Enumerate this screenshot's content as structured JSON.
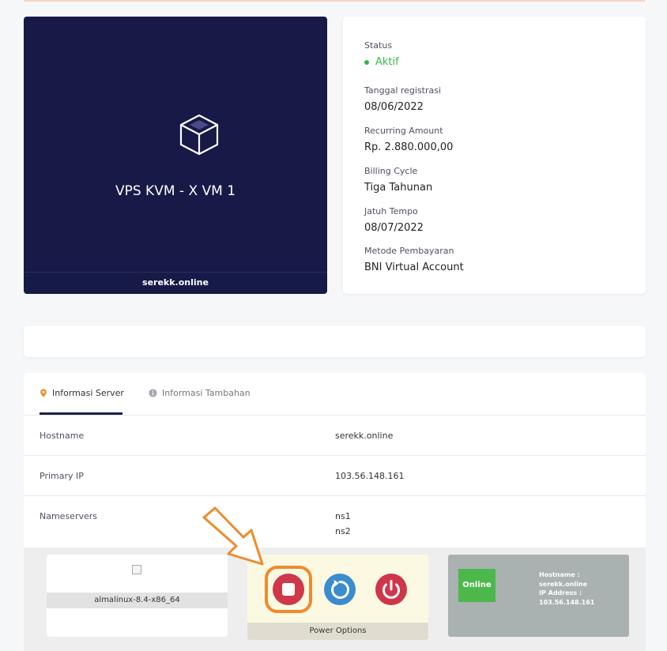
{
  "product": {
    "name": "VPS KVM - X VM 1",
    "domain": "serekk.online",
    "icon": "cube-icon"
  },
  "details": {
    "status_label": "Status",
    "status_value": "Aktif",
    "registration_label": "Tanggal registrasi",
    "registration_value": "08/06/2022",
    "recurring_label": "Recurring Amount",
    "recurring_value": "Rp. 2.880.000,00",
    "billing_label": "Billing Cycle",
    "billing_value": "Tiga Tahunan",
    "due_label": "Jatuh Tempo",
    "due_value": "08/07/2022",
    "payment_label": "Metode Pembayaran",
    "payment_value": "BNI Virtual Account"
  },
  "tabs": [
    {
      "label": "Informasi Server",
      "icon": "location-pin-icon"
    },
    {
      "label": "Informasi Tambahan",
      "icon": "info-icon"
    }
  ],
  "server_info": {
    "hostname_label": "Hostname",
    "hostname_value": "serekk.online",
    "ip_label": "Primary IP",
    "ip_value": "103.56.148.161",
    "ns_label": "Nameservers",
    "ns1": "ns1",
    "ns2": "ns2"
  },
  "os": {
    "label": "almalinux-8.4-x86_64"
  },
  "power": {
    "label": "Power Options"
  },
  "vm_status": {
    "badge": "Online",
    "hostname_label": "Hostname :",
    "hostname_value": "serekk.online",
    "ip_label": "IP Address :",
    "ip_value": "103.56.148.161"
  },
  "colors": {
    "product_bg": "#171a47",
    "status_green": "#39b54a",
    "stop_red": "#cf3848",
    "restart_blue": "#3a8ccf",
    "highlight_orange": "#f08a2c"
  }
}
